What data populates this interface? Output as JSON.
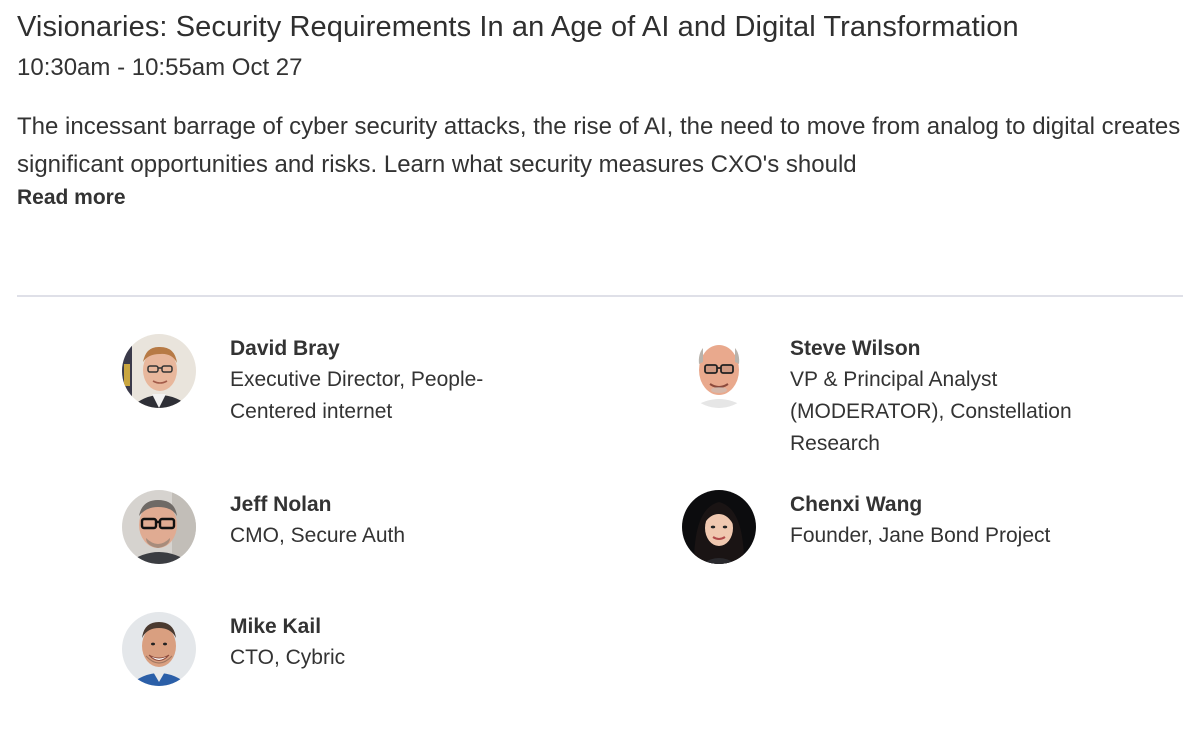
{
  "session": {
    "title": "Visionaries: Security Requirements In an Age of AI and Digital Transformation",
    "time": "10:30am - 10:55am Oct 27",
    "description": "The incessant barrage of cyber security attacks, the rise of AI, the need to move from analog to digital creates significant opportunities and risks. Learn what security measures CXO's should",
    "read_more": "Read more"
  },
  "speakers": [
    {
      "name": "David Bray",
      "role": "Executive Director, People-Centered internet",
      "avatar": "avatar-photo"
    },
    {
      "name": "Steve Wilson",
      "role": "VP & Principal Analyst (MODERATOR), Constellation Research",
      "avatar": "avatar-photo"
    },
    {
      "name": "Jeff Nolan",
      "role": "CMO, Secure Auth",
      "avatar": "avatar-photo"
    },
    {
      "name": "Chenxi Wang",
      "role": "Founder, Jane Bond Project",
      "avatar": "avatar-photo"
    },
    {
      "name": "Mike Kail",
      "role": "CTO, Cybric",
      "avatar": "avatar-photo"
    }
  ],
  "colors": {
    "text": "#333333",
    "divider": "#dfe0e8",
    "background": "#ffffff"
  }
}
